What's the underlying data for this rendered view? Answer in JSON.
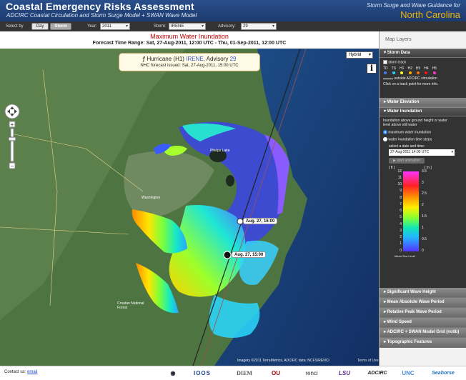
{
  "header": {
    "title": "Coastal Emergency Risks Assessment",
    "subtitle": "ADCIRC Coastal Circulation and Storm Surge Model + SWAN Wave Model",
    "right_top": "Storm Surge and Wave Guidance for",
    "region": "North Carolina"
  },
  "toolbar": {
    "select_by_label": "Select by",
    "day_label": "Day",
    "storm_label": "Storm",
    "year_label": "Year:",
    "year_value": "2011",
    "storm_field_label": "Storm:",
    "storm_value": "IRENE",
    "advisory_label": "Advisory:",
    "advisory_value": "29"
  },
  "map_titles": {
    "main": "Maximum Water Inundation",
    "range": "Forecast Time Range:  Sat, 27-Aug-2011, 12:00 UTC  -  Thu, 01-Sep-2011, 12:00 UTC"
  },
  "infobox": {
    "hurricane_prefix": "Hurricane (H1)",
    "storm_name": "IRENE",
    "advisory_text": ", Advisory",
    "advisory_num": "29",
    "issued": "NHC forecast issued: Sat, 27-Aug-2011, 15:00 UTC"
  },
  "map": {
    "type_value": "Hybrid",
    "info_glyph": "i",
    "track_labels": [
      "Aug. 27, 16:00",
      "Aug. 27, 15:00"
    ],
    "place_labels": [
      "Phelps Lake",
      "Washington",
      "Croatan National Forest"
    ],
    "credit": "Imagery ©2011 TerraMetrics, ADCIRC data: NCFS/RENCI",
    "terms": "Terms of Use"
  },
  "panel": {
    "header": "Map Layers",
    "storm_data": "Storm Data",
    "storm_track": "storm track",
    "categories": [
      "TD",
      "TS",
      "H1",
      "H2",
      "H3",
      "H4",
      "H5"
    ],
    "category_colors": [
      "#4a7bff",
      "#2ad0ff",
      "#ffff33",
      "#ffb000",
      "#ff6a00",
      "#ff1111",
      "#ff33cc"
    ],
    "outside_text": "outside ADCIRC simulation",
    "click_hint": "Click on a track point for more info.",
    "water_elevation": "Water Elevation",
    "water_inundation": "Water Inundation",
    "inund_desc": "Inundation above ground height or water level above still water",
    "opt_max": "maximum water inundation",
    "opt_steps": "water inundation time steps",
    "date_hint": "select a date and time:",
    "date_value": "27-Aug-2011 14:00 UTC",
    "start_animation": "start animation",
    "unit_ft": "[ ft ]",
    "unit_m": "[ m ]",
    "ft_ticks": [
      "12",
      "11",
      "10",
      "9",
      "8",
      "7",
      "6",
      "5",
      "4",
      "3",
      "2",
      "1",
      "0"
    ],
    "m_ticks": [
      "3.5",
      "3",
      "2.5",
      "2",
      "1.5",
      "1",
      "0.5",
      "0"
    ],
    "msl": "Mean Sea Level",
    "layers": [
      "Significant Wave Height",
      "Mean Absolute Wave Period",
      "Relative Peak Wave Period",
      "Wind Speed",
      "ADCIRC + SWAN Model Grid (nc6b)",
      "Topographic Features"
    ]
  },
  "footer": {
    "contact": "Contact us:",
    "email": "email",
    "logos": [
      "IOOS",
      "DIEM",
      "OU",
      "renci",
      "LSU",
      "ADCIRC",
      "UNC",
      "Seahorse"
    ]
  },
  "colors": {
    "header_bg": "#1f3f76",
    "region_gold": "#f5b400",
    "title_red": "#c40000"
  }
}
